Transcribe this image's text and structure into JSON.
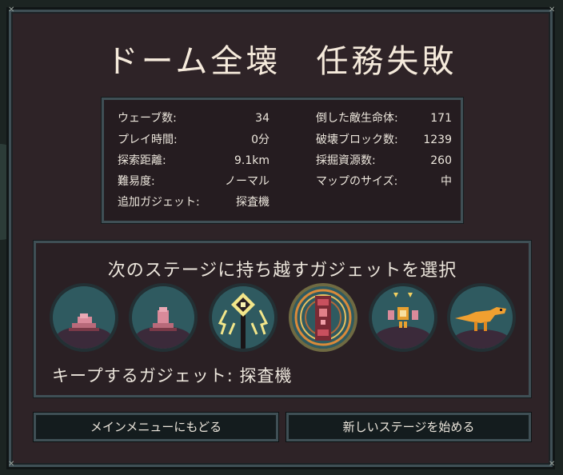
{
  "title": "ドーム全壊　任務失敗",
  "stats_left": [
    {
      "label": "ウェーブ数:",
      "value": "34"
    },
    {
      "label": "プレイ時間:",
      "value": "0分"
    },
    {
      "label": "探索距離:",
      "value": "9.1km"
    },
    {
      "label": "難易度:",
      "value": "ノーマル"
    },
    {
      "label": "追加ガジェット:",
      "value": "探査機"
    }
  ],
  "stats_right": [
    {
      "label": "倒した敵生命体:",
      "value": "171"
    },
    {
      "label": "破壊ブロック数:",
      "value": "1239"
    },
    {
      "label": "採掘資源数:",
      "value": "260"
    },
    {
      "label": "マップのサイズ:",
      "value": "中"
    }
  ],
  "gadget_select": {
    "heading": "次のステージに持ち越すガジェットを選択",
    "gadgets": [
      {
        "icon": "dome-turret-icon",
        "selected": false
      },
      {
        "icon": "dome-cannon-icon",
        "selected": false
      },
      {
        "icon": "orb-shield-icon",
        "selected": false
      },
      {
        "icon": "probe-device-icon",
        "selected": true
      },
      {
        "icon": "drone-helper-icon",
        "selected": false
      },
      {
        "icon": "dinosaur-pet-icon",
        "selected": false
      }
    ],
    "keep_text": "キープするガジェット: 探査機"
  },
  "buttons": {
    "main_menu": "メインメニューにもどる",
    "new_stage": "新しいステージを始める"
  },
  "colors": {
    "panel_bg": "#2e2327",
    "border": "#3f4f55",
    "text": "#ece6dc",
    "accent_orange": "#f0a030",
    "accent_pink": "#d98a9a"
  }
}
